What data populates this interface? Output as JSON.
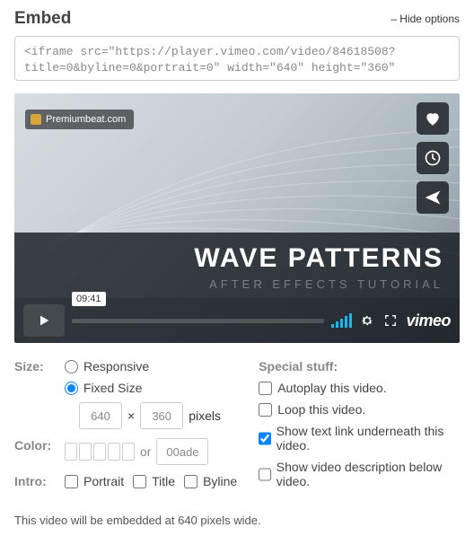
{
  "header": {
    "title": "Embed",
    "hide": "– Hide options"
  },
  "embed_code": "<iframe src=\"https://player.vimeo.com/video/84618508?title=0&byline=0&portrait=0\" width=\"640\" height=\"360\"",
  "player": {
    "brand": "Premiumbeat.com",
    "title": "WAVE PATTERNS",
    "subtitle": "AFTER EFFECTS TUTORIAL",
    "duration": "09:41",
    "logo": "vimeo"
  },
  "size": {
    "label": "Size:",
    "responsive": "Responsive",
    "fixed": "Fixed Size",
    "width": "640",
    "height": "360",
    "x": "×",
    "pixels": "pixels"
  },
  "color": {
    "label": "Color:",
    "or": "or",
    "value": "00ade"
  },
  "intro": {
    "label": "Intro:",
    "portrait": "Portrait",
    "title": "Title",
    "byline": "Byline"
  },
  "special": {
    "label": "Special stuff:",
    "autoplay": "Autoplay this video.",
    "loop": "Loop this video.",
    "textlink": "Show text link underneath this video.",
    "desc": "Show video description below video."
  },
  "footnote": "This video will be embedded at 640 pixels wide."
}
